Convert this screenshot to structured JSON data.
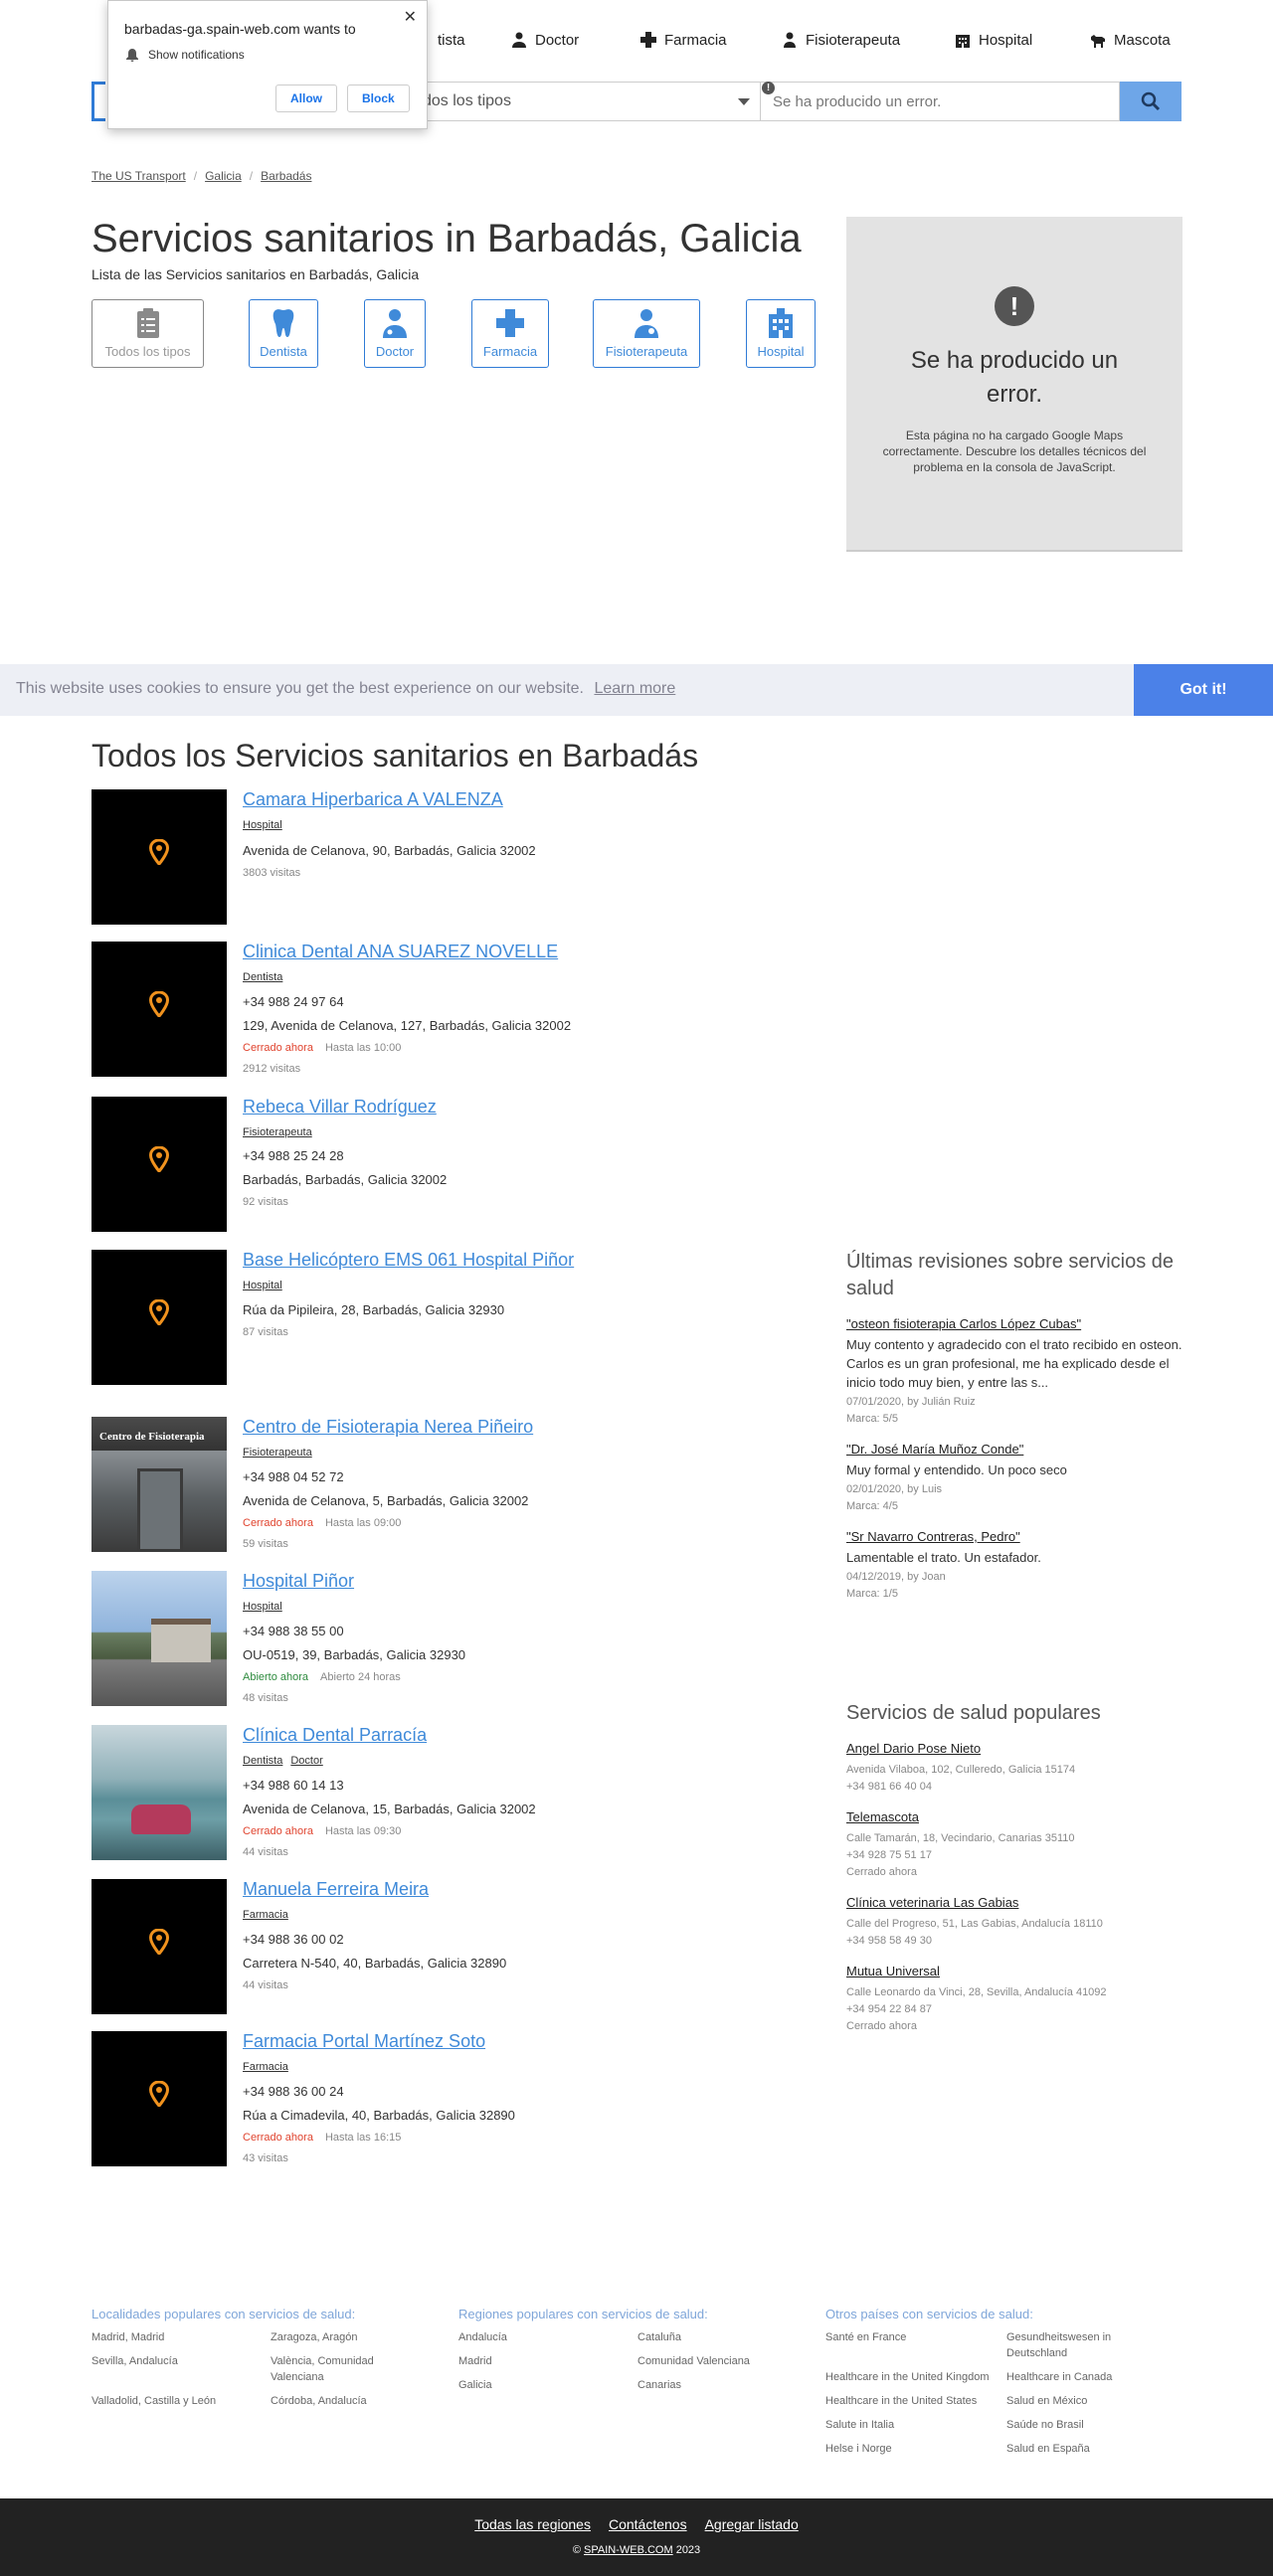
{
  "notification": {
    "title": "barbadas-ga.spain-web.com wants to",
    "row": "Show notifications",
    "allow": "Allow",
    "block": "Block"
  },
  "nav": [
    {
      "label": "Dentista",
      "visible": "tista"
    },
    {
      "label": "Doctor"
    },
    {
      "label": "Farmacia"
    },
    {
      "label": "Fisioterapeuta"
    },
    {
      "label": "Hospital"
    },
    {
      "label": "Mascota"
    }
  ],
  "search": {
    "select_value": "Todos los tipos",
    "select_visible": "dos los tipos",
    "input_value": "Se ha producido un error."
  },
  "breadcrumb": [
    "The US Transport",
    "Galicia",
    "Barbadás"
  ],
  "page": {
    "title": "Servicios sanitarios in Barbadás, Galicia",
    "subtitle": "Lista de las Servicios sanitarios en Barbadás, Galicia"
  },
  "types": [
    "Todos los tipos",
    "Dentista",
    "Doctor",
    "Farmacia",
    "Fisioterapeuta",
    "Hospital"
  ],
  "map_error": {
    "title": "Se ha producido un error.",
    "text": "Esta página no ha cargado Google Maps correctamente. Descubre los detalles técnicos del problema en la consola de JavaScript."
  },
  "cookie": {
    "message": "This website uses cookies to ensure you get the best experience on our website.",
    "learn_more": "Learn more",
    "accept": "Got it!"
  },
  "section_title": "Todos los Servicios sanitarios en Barbadás",
  "listings": [
    {
      "name": "Camara Hiperbarica A VALENZA",
      "tags": [
        "Hospital"
      ],
      "phone": "",
      "address": "Avenida de Celanova, 90, Barbadás, Galicia 32002",
      "status": "",
      "hours": "",
      "visits": "3803 visitas"
    },
    {
      "name": "Clinica Dental ANA SUAREZ NOVELLE",
      "tags": [
        "Dentista"
      ],
      "phone": "+34 988 24 97 64",
      "address": "129, Avenida de Celanova, 127, Barbadás, Galicia 32002",
      "status": "Cerrado ahora",
      "hours": "Hasta las 10:00",
      "visits": "2912 visitas"
    },
    {
      "name": "Rebeca Villar Rodríguez",
      "tags": [
        "Fisioterapeuta"
      ],
      "phone": "+34 988 25 24 28",
      "address": "Barbadás, Barbadás, Galicia 32002",
      "status": "",
      "hours": "",
      "visits": "92 visitas"
    },
    {
      "name": "Base Helicóptero EMS 061 Hospital Piñor",
      "tags": [
        "Hospital"
      ],
      "phone": "",
      "address": "Rúa da Pipileira, 28, Barbadás, Galicia 32930",
      "status": "",
      "hours": "",
      "visits": "87 visitas"
    },
    {
      "name": "Centro de Fisioterapia Nerea Piñeiro",
      "tags": [
        "Fisioterapeuta"
      ],
      "phone": "+34 988 04 52 72",
      "address": "Avenida de Celanova, 5, Barbadás, Galicia 32002",
      "status": "Cerrado ahora",
      "hours": "Hasta las 09:00",
      "visits": "59 visitas",
      "photo_sign": "Centro de Fisioterapia"
    },
    {
      "name": "Hospital Piñor",
      "tags": [
        "Hospital"
      ],
      "phone": "+34 988 38 55 00",
      "address": "OU-0519, 39, Barbadás, Galicia 32930",
      "status": "Abierto ahora",
      "hours": "Abierto 24 horas",
      "visits": "48 visitas"
    },
    {
      "name": "Clínica Dental Parracía",
      "tags": [
        "Dentista",
        "Doctor"
      ],
      "phone": "+34 988 60 14 13",
      "address": "Avenida de Celanova, 15, Barbadás, Galicia 32002",
      "status": "Cerrado ahora",
      "hours": "Hasta las 09:30",
      "visits": "44 visitas"
    },
    {
      "name": "Manuela Ferreira Meira",
      "tags": [
        "Farmacia"
      ],
      "phone": "+34 988 36 00 02",
      "address": "Carretera N-540, 40, Barbadás, Galicia 32890",
      "status": "",
      "hours": "",
      "visits": "44 visitas"
    },
    {
      "name": "Farmacia Portal Martínez Soto",
      "tags": [
        "Farmacia"
      ],
      "phone": "+34 988 36 00 24",
      "address": "Rúa a Cimadevila, 40, Barbadás, Galicia 32890",
      "status": "Cerrado ahora",
      "hours": "Hasta las 16:15",
      "visits": "43 visitas"
    }
  ],
  "reviews": {
    "title": "Últimas revisiones sobre servicios de salud",
    "items": [
      {
        "name": "\"osteon fisioterapia Carlos López Cubas\"",
        "text": "Muy contento y agradecido con el trato recibido en osteon. Carlos es un gran profesional, me ha explicado desde el inicio todo muy bien, y entre las s...",
        "date": "07/01/2020, by Julián Ruiz",
        "mark": "Marca: 5/5"
      },
      {
        "name": "\"Dr. José María Muñoz Conde\"",
        "text": "Muy formal y entendido. Un poco seco",
        "date": "02/01/2020, by Luis",
        "mark": "Marca: 4/5"
      },
      {
        "name": "\"Sr Navarro Contreras, Pedro\"",
        "text": "Lamentable el trato. Un estafador.",
        "date": "04/12/2019, by Joan",
        "mark": "Marca: 1/5"
      }
    ]
  },
  "popular": {
    "title": "Servicios de salud populares",
    "items": [
      {
        "name": "Angel Dario Pose Nieto",
        "address": "Avenida Vilaboa, 102, Culleredo, Galicia 15174",
        "phone": "+34 981 66 40 04",
        "status": ""
      },
      {
        "name": "Telemascota",
        "address": "Calle Tamarán, 18, Vecindario, Canarias 35110",
        "phone": "+34 928 75 51 17",
        "status": "Cerrado ahora"
      },
      {
        "name": "Clínica veterinaria Las Gabias",
        "address": "Calle del Progreso, 51, Las Gabias, Andalucía 18110",
        "phone": "+34 958 58 49 30",
        "status": ""
      },
      {
        "name": "Mutua Universal",
        "address": "Calle Leonardo da Vinci, 28, Sevilla, Andalucía 41092",
        "phone": "+34 954 22 84 87",
        "status": "Cerrado ahora"
      }
    ]
  },
  "footer_cols": [
    {
      "title": "Localidades populares con servicios de salud:",
      "links": [
        "Madrid, Madrid",
        "Zaragoza, Aragón",
        "Sevilla, Andalucía",
        "València, Comunidad Valenciana",
        "Valladolid, Castilla y León",
        "Córdoba, Andalucía"
      ]
    },
    {
      "title": "Regiones populares con servicios de salud:",
      "links": [
        "Andalucía",
        "Cataluña",
        "Madrid",
        "Comunidad Valenciana",
        "Galicia",
        "Canarias"
      ]
    },
    {
      "title": "Otros países con servicios de salud:",
      "links": [
        "Santé en France",
        "Gesundheitswesen in Deutschland",
        "Healthcare in the United Kingdom",
        "Healthcare in Canada",
        "Healthcare in the United States",
        "Salud en México",
        "Salute in Italia",
        "Saúde no Brasil",
        "Helse i Norge",
        "Salud en España"
      ]
    }
  ],
  "footer": {
    "links": [
      "Todas las regiones",
      "Contáctenos",
      "Agregar listado"
    ],
    "copy_prefix": "© ",
    "brand": "SPAIN-WEB.COM",
    "year": " 2023"
  },
  "colors": {
    "accent": "#3f8ad9",
    "closed": "#e0442f",
    "open": "#2e8b3e",
    "cookie_button": "#4b81e8"
  }
}
